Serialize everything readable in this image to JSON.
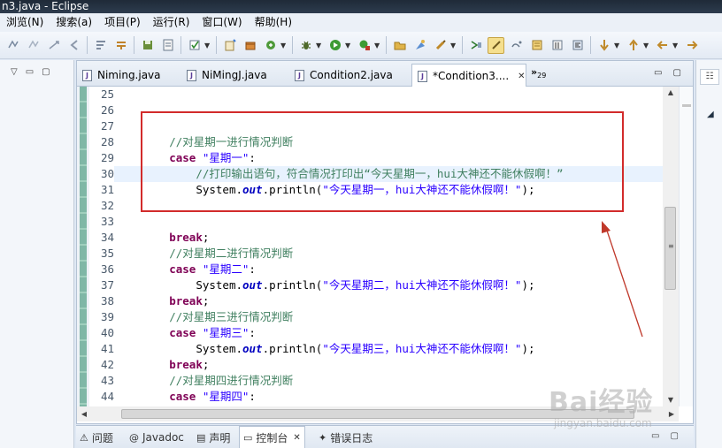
{
  "window": {
    "title": "n3.java - Eclipse"
  },
  "menubar": {
    "items": [
      "浏览(N)",
      "搜索(a)",
      "项目(P)",
      "运行(R)",
      "窗口(W)",
      "帮助(H)"
    ]
  },
  "toolbar": {
    "icons": [
      "next-annotation-icon",
      "prev-annotation-icon",
      "last-edit-icon",
      "back-icon",
      "forward-icon",
      "word-wrap-icon",
      "build-icon",
      "save-icon",
      "task-list-icon",
      "new-java-project-icon",
      "new-package-icon",
      "new-class-icon",
      "debug-icon",
      "run-icon",
      "run-external-icon",
      "open-type-icon",
      "open-resource-icon",
      "search-icon",
      "toggle-breadcrumb-icon",
      "mark-occurrences-icon",
      "show-whitespace-icon",
      "block-selection-icon",
      "paragraph-icon",
      "next-edit-icon",
      "prev-edit-icon",
      "pin-icon"
    ]
  },
  "editor": {
    "tabs": [
      {
        "label": "Niming.java",
        "active": false
      },
      {
        "label": "NiMingJ.java",
        "active": false
      },
      {
        "label": "Condition2.java",
        "active": false
      },
      {
        "label": "*Condition3....",
        "active": true
      }
    ],
    "overflow_count": "29",
    "overflow_glyph": "»",
    "lines": [
      {
        "num": "25",
        "text": ""
      },
      {
        "num": "26",
        "text": ""
      },
      {
        "num": "27",
        "text": ""
      },
      {
        "num": "28",
        "indent": "        ",
        "kind": "comment",
        "text": "//对星期一进行情况判断"
      },
      {
        "num": "29",
        "indent": "        ",
        "kind": "case",
        "kw": "case",
        "str": "\"星期一\"",
        "tail": ":"
      },
      {
        "num": "30",
        "indent": "            ",
        "kind": "comment",
        "text": "//打印输出语句，符合情况打印出“今天星期一，hui大神还不能休假啊！”",
        "highlight": true
      },
      {
        "num": "31",
        "indent": "            ",
        "kind": "println",
        "pre": "System.",
        "field": "out",
        "mid": ".println(",
        "str": "\"今天星期一，hui大神还不能休假啊！\"",
        "tail": ");"
      },
      {
        "num": "32",
        "text": ""
      },
      {
        "num": "33",
        "text": ""
      },
      {
        "num": "34",
        "indent": "        ",
        "kind": "kw",
        "kw": "break",
        "tail": ";"
      },
      {
        "num": "35",
        "indent": "        ",
        "kind": "comment",
        "text": "//对星期二进行情况判断"
      },
      {
        "num": "36",
        "indent": "        ",
        "kind": "case",
        "kw": "case",
        "str": "\"星期二\"",
        "tail": ":"
      },
      {
        "num": "37",
        "indent": "            ",
        "kind": "println",
        "pre": "System.",
        "field": "out",
        "mid": ".println(",
        "str": "\"今天星期二，hui大神还不能休假啊！\"",
        "tail": ");"
      },
      {
        "num": "38",
        "indent": "        ",
        "kind": "kw",
        "kw": "break",
        "tail": ";"
      },
      {
        "num": "39",
        "indent": "        ",
        "kind": "comment",
        "text": "//对星期三进行情况判断"
      },
      {
        "num": "40",
        "indent": "        ",
        "kind": "case",
        "kw": "case",
        "str": "\"星期三\"",
        "tail": ":"
      },
      {
        "num": "41",
        "indent": "            ",
        "kind": "println",
        "pre": "System.",
        "field": "out",
        "mid": ".println(",
        "str": "\"今天星期三，hui大神还不能休假啊！\"",
        "tail": ");"
      },
      {
        "num": "42",
        "indent": "        ",
        "kind": "kw",
        "kw": "break",
        "tail": ";"
      },
      {
        "num": "43",
        "indent": "        ",
        "kind": "comment",
        "text": "//对星期四进行情况判断"
      },
      {
        "num": "44",
        "indent": "        ",
        "kind": "case",
        "kw": "case",
        "str": "\"星期四\"",
        "tail": ":"
      }
    ]
  },
  "bottom_panel": {
    "tabs": [
      {
        "icon": "problems-icon",
        "glyph": "⚠",
        "label": "问题",
        "active": false
      },
      {
        "icon": "javadoc-icon",
        "glyph": "@",
        "label": "Javadoc",
        "active": false
      },
      {
        "icon": "declaration-icon",
        "glyph": "▤",
        "label": "声明",
        "active": false
      },
      {
        "icon": "console-icon",
        "glyph": "▭",
        "label": "控制台",
        "active": true
      },
      {
        "icon": "error-log-icon",
        "glyph": "✦",
        "label": "错误日志",
        "active": false
      }
    ]
  },
  "watermark": {
    "logo": "Bai经验",
    "url": "jingyan.baidu.com"
  },
  "colors": {
    "comment": "#3f7f5f",
    "keyword": "#7f0055",
    "string": "#2a00ff",
    "field": "#0000c0",
    "annotation": "#d22b2b",
    "current_line": "#e8f2fe"
  }
}
